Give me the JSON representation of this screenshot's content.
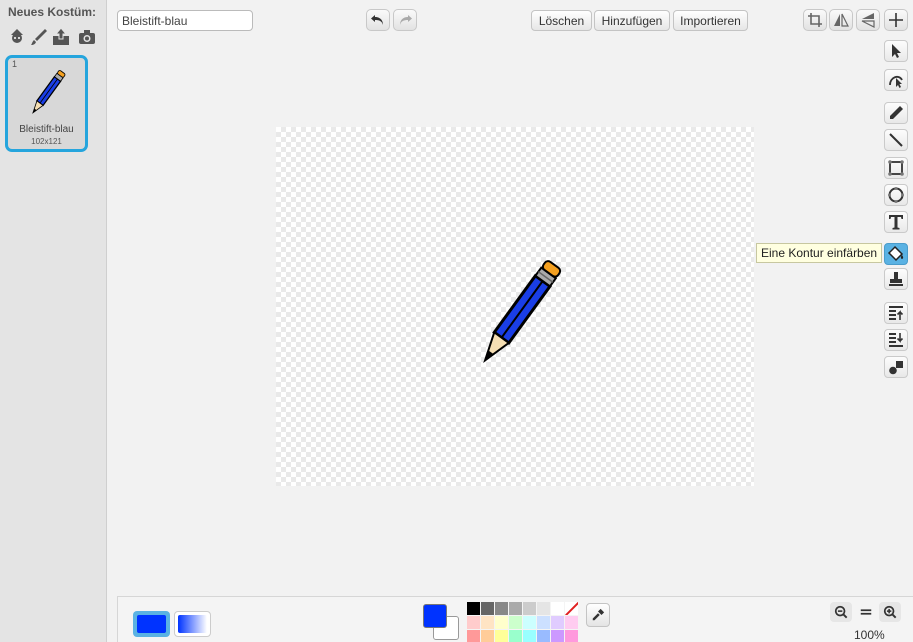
{
  "new_costume": {
    "title": "Neues Kostüm:",
    "icons": [
      "character-library-icon",
      "paintbrush-icon",
      "upload-icon",
      "camera-icon"
    ]
  },
  "costumes": [
    {
      "index": "1",
      "name": "Bleistift-blau",
      "size": "102x121"
    }
  ],
  "toolbar": {
    "costume_name": "Bleistift-blau",
    "undo_icon": "undo-icon",
    "redo_icon": "redo-icon",
    "clear_label": "Löschen",
    "add_label": "Hinzufügen",
    "import_label": "Importieren",
    "right_icons": [
      "crop-icon",
      "flip-horizontal-icon",
      "flip-vertical-icon",
      "set-center-icon"
    ]
  },
  "tools": [
    "select-tool-icon",
    "reshape-tool-icon",
    "pencil-tool-icon",
    "line-tool-icon",
    "rectangle-tool-icon",
    "ellipse-tool-icon",
    "text-tool-icon",
    "color-shape-tool-icon",
    "stamp-tool-icon",
    "bring-forward-icon",
    "send-backward-icon",
    "ungroup-icon"
  ],
  "active_tool": "color-shape-tool-icon",
  "tooltip": "Eine Kontur einfärben",
  "colors": {
    "primary": "#0033ff",
    "secondary": "#ffffff",
    "accent": "#25a5dd",
    "active_tool_bg": "#5ab2e3",
    "pencil_body": "#1a3ee6",
    "pencil_eraser": "#f4a020"
  },
  "palette": [
    "#000000",
    "#666666",
    "#888888",
    "#aaaaaa",
    "#cccccc",
    "#e5e5e5",
    "#ffffff",
    "none",
    "#ffcccc",
    "#ffe4c4",
    "#ffffcc",
    "#ccffcc",
    "#ccffff",
    "#cce0ff",
    "#e0ccff",
    "#ffccf0",
    "#ff9999",
    "#ffcc99",
    "#ffff99",
    "#99ffcc",
    "#99ffff",
    "#99bbff",
    "#cc99ff",
    "#ff99dd"
  ],
  "fill_modes": [
    "solid",
    "gradient"
  ],
  "zoom": {
    "level": "100%",
    "zoom_out_icon": "zoom-out-icon",
    "reset_icon": "zoom-reset-icon",
    "zoom_in_icon": "zoom-in-icon"
  }
}
